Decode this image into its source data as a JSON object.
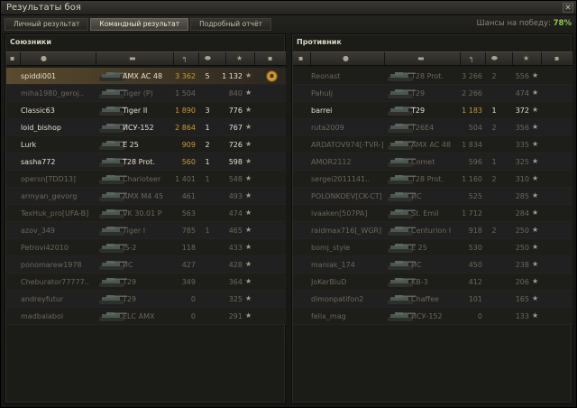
{
  "window": {
    "title": "Результаты боя",
    "close_label": "✕"
  },
  "tabs": [
    "Личный результат",
    "Командный результат",
    "Подробный отчёт"
  ],
  "active_tab": 1,
  "chance": {
    "label": "Шансы на победу:",
    "value": "78%"
  },
  "colors": {
    "accent": "#93c34f",
    "damage": "#c79a3e",
    "highlight": "#5a4a2e"
  },
  "allies": {
    "title": "Союзники",
    "rows": [
      {
        "name": "spiddi001",
        "vehicle": "AMX AC 48",
        "damage": "3 362",
        "kills": "5",
        "xp": "1 132",
        "alive": true,
        "me": true,
        "medal": true
      },
      {
        "name": "miha1980_geroj..",
        "vehicle": "Tiger (P)",
        "damage": "1 504",
        "kills": "",
        "xp": "840",
        "alive": false
      },
      {
        "name": "Classic63",
        "vehicle": "Tiger II",
        "damage": "1 890",
        "kills": "3",
        "xp": "776",
        "alive": true
      },
      {
        "name": "loid_bishop",
        "vehicle": "ИСУ-152",
        "damage": "2 864",
        "kills": "1",
        "xp": "767",
        "alive": true
      },
      {
        "name": "Lurk",
        "vehicle": "E 25",
        "damage": "909",
        "kills": "2",
        "xp": "726",
        "alive": true
      },
      {
        "name": "sasha772",
        "vehicle": "T28 Prot.",
        "damage": "560",
        "kills": "1",
        "xp": "598",
        "alive": true
      },
      {
        "name": "opersn[TDD13]",
        "vehicle": "Charioteer",
        "damage": "1 401",
        "kills": "1",
        "xp": "548",
        "alive": false
      },
      {
        "name": "armyan_gevorg",
        "vehicle": "AMX M4 45",
        "damage": "461",
        "kills": "",
        "xp": "493",
        "alive": false
      },
      {
        "name": "TexHuk_pro[UFA-B]",
        "vehicle": "VK 30.01 P",
        "damage": "563",
        "kills": "",
        "xp": "474",
        "alive": false
      },
      {
        "name": "azov_349",
        "vehicle": "Tiger I",
        "damage": "785",
        "kills": "1",
        "xp": "465",
        "alive": false
      },
      {
        "name": "Petrovi42010",
        "vehicle": "IS-2",
        "damage": "118",
        "kills": "",
        "xp": "433",
        "alive": false
      },
      {
        "name": "ponomarew1978",
        "vehicle": "ИС",
        "damage": "427",
        "kills": "",
        "xp": "428",
        "alive": false
      },
      {
        "name": "Cheburator77777..",
        "vehicle": "T29",
        "damage": "349",
        "kills": "",
        "xp": "364",
        "alive": false
      },
      {
        "name": "andreyfutur",
        "vehicle": "T29",
        "damage": "0",
        "kills": "",
        "xp": "325",
        "alive": false
      },
      {
        "name": "madbalabol",
        "vehicle": "ELC AMX",
        "damage": "0",
        "kills": "",
        "xp": "291",
        "alive": false
      }
    ]
  },
  "enemies": {
    "title": "Противник",
    "rows": [
      {
        "name": "Reonast",
        "vehicle": "T28 Prot.",
        "damage": "3 266",
        "kills": "2",
        "xp": "556",
        "alive": false
      },
      {
        "name": "Pahulj",
        "vehicle": "T29",
        "damage": "2 266",
        "kills": "",
        "xp": "474",
        "alive": false
      },
      {
        "name": "barrei",
        "vehicle": "T29",
        "damage": "1 183",
        "kills": "1",
        "xp": "372",
        "alive": true
      },
      {
        "name": "ruta2009",
        "vehicle": "T26E4",
        "damage": "504",
        "kills": "2",
        "xp": "356",
        "alive": false
      },
      {
        "name": "ARDATOV974[-TVR-]",
        "vehicle": "AMX AC 48",
        "damage": "1 834",
        "kills": "",
        "xp": "335",
        "alive": false
      },
      {
        "name": "AMOR2112",
        "vehicle": "Comet",
        "damage": "596",
        "kills": "1",
        "xp": "325",
        "alive": false
      },
      {
        "name": "sergei2011141..",
        "vehicle": "T28 Prot.",
        "damage": "1 160",
        "kills": "2",
        "xp": "310",
        "alive": false
      },
      {
        "name": "POLONKOEV[CK-CT]",
        "vehicle": "ИС",
        "damage": "525",
        "kills": "",
        "xp": "285",
        "alive": false
      },
      {
        "name": "ivaaken[507PA]",
        "vehicle": "St. Emil",
        "damage": "1 712",
        "kills": "",
        "xp": "284",
        "alive": false
      },
      {
        "name": "raidmax716[_WGR]",
        "vehicle": "Centurion I",
        "damage": "918",
        "kills": "2",
        "xp": "250",
        "alive": false
      },
      {
        "name": "bomj_style",
        "vehicle": "E 25",
        "damage": "530",
        "kills": "",
        "xp": "250",
        "alive": false
      },
      {
        "name": "maniak_174",
        "vehicle": "ИС",
        "damage": "450",
        "kills": "",
        "xp": "238",
        "alive": false
      },
      {
        "name": "JoKerBluD",
        "vehicle": "KB-3",
        "damage": "412",
        "kills": "",
        "xp": "206",
        "alive": false
      },
      {
        "name": "dimonpatifon2",
        "vehicle": "Chaffee",
        "damage": "101",
        "kills": "",
        "xp": "165",
        "alive": false
      },
      {
        "name": "felix_mag",
        "vehicle": "ИСУ-152",
        "damage": "0",
        "kills": "",
        "xp": "133",
        "alive": false
      }
    ]
  }
}
